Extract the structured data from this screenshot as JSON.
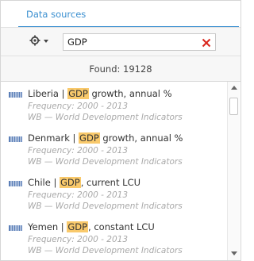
{
  "tab": {
    "label": "Data sources"
  },
  "search": {
    "value": "GDP",
    "placeholder": ""
  },
  "found": {
    "text": "Found: 19128"
  },
  "results": [
    {
      "prefix": "Liberia | ",
      "highlight": "GDP",
      "suffix": " growth, annual %",
      "frequency": "Frequency: 2000 - 2013",
      "source": "WB — World Development Indicators"
    },
    {
      "prefix": "Denmark | ",
      "highlight": "GDP",
      "suffix": " growth, annual %",
      "frequency": "Frequency: 2000 - 2013",
      "source": "WB — World Development Indicators"
    },
    {
      "prefix": "Chile | ",
      "highlight": "GDP",
      "suffix": ", current LCU",
      "frequency": "Frequency: 2000 - 2013",
      "source": "WB — World Development Indicators"
    },
    {
      "prefix": "Yemen | ",
      "highlight": "GDP",
      "suffix": ", constant LCU",
      "frequency": "Frequency: 2000 - 2013",
      "source": "WB — World Development Indicators"
    }
  ],
  "colors": {
    "accent": "#3a8fd0",
    "highlight": "#f9c96b",
    "clear": "#d9251c",
    "muted_text": "#a9a9a9"
  },
  "icons": {
    "settings": "gear-icon",
    "clear": "close-icon",
    "dataset": "dataset-icon"
  }
}
